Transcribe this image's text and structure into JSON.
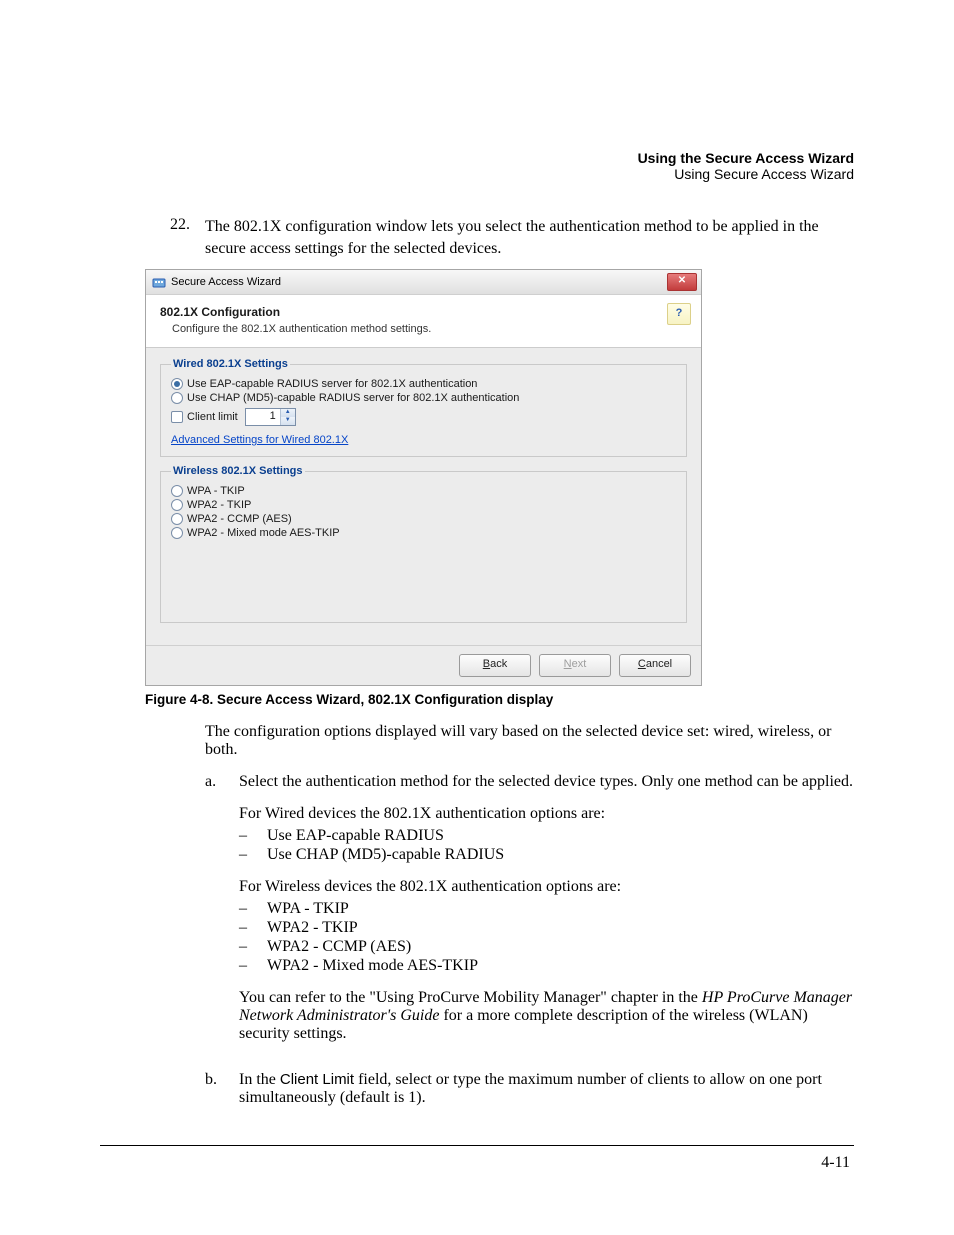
{
  "header": {
    "bold": "Using the Secure Access Wizard",
    "reg": "Using Secure Access Wizard"
  },
  "step22": {
    "num": "22.",
    "text": "The 802.1X configuration window lets you select the authentication method to be applied in the secure access settings for the selected devices."
  },
  "wizard": {
    "titlebar": "Secure Access Wizard",
    "close_glyph": "✕",
    "help_glyph": "?",
    "head_title": "802.1X Configuration",
    "head_sub": "Configure the 802.1X authentication method settings.",
    "wired": {
      "legend": "Wired 802.1X Settings",
      "opt_eap": "Use EAP-capable RADIUS server for 802.1X authentication",
      "opt_chap": "Use CHAP (MD5)-capable RADIUS server for 802.1X authentication",
      "client_limit_label": "Client limit",
      "client_limit_value": "1",
      "advanced_link": "Advanced Settings for Wired 802.1X"
    },
    "wireless": {
      "legend": "Wireless 802.1X Settings",
      "opt_wpa_tkip": "WPA - TKIP",
      "opt_wpa2_tkip": "WPA2 - TKIP",
      "opt_wpa2_ccmp": "WPA2 - CCMP (AES)",
      "opt_wpa2_mixed": "WPA2 - Mixed mode AES-TKIP"
    },
    "buttons": {
      "back": "Back",
      "next": "Next",
      "cancel": "Cancel"
    }
  },
  "figcaption": "Figure 4-8. Secure Access Wizard, 802.1X Configuration display",
  "para_vary": "The configuration options displayed will vary based on the selected device set: wired, wireless, or both.",
  "sub_a": {
    "label": "a.",
    "lead": "Select the authentication method for the selected device types. Only one method can be applied.",
    "wired_intro": "For Wired devices the 802.1X authentication options are:",
    "wired_items": [
      "Use EAP-capable RADIUS",
      "Use CHAP (MD5)-capable RADIUS"
    ],
    "wireless_intro": "For Wireless devices the 802.1X authentication options are:",
    "wireless_items": [
      "WPA - TKIP",
      "WPA2 - TKIP",
      "WPA2 - CCMP (AES)",
      "WPA2 - Mixed mode AES-TKIP"
    ],
    "refer_pre": "You can refer to the \"Using ProCurve Mobility Manager\" chapter in the ",
    "refer_italic": "HP ProCurve Manager Network Administrator's Guide",
    "refer_post": " for a more complete description of the wireless (WLAN) security settings."
  },
  "sub_b": {
    "label": "b.",
    "pre": "In the ",
    "field_name": "Client Limit",
    "post": " field, select or type the maximum number of clients to allow on one port simultaneously (default is 1)."
  },
  "page_number": "4-11"
}
